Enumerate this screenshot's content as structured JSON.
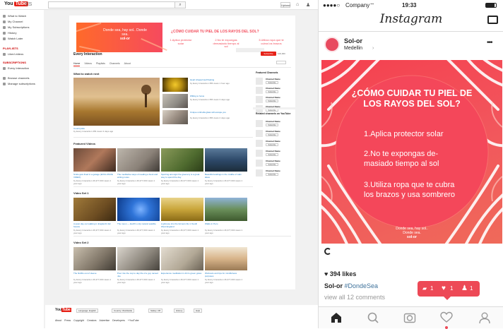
{
  "youtube": {
    "logo": "You",
    "logo_tube": "Tube",
    "logo_suffix": "ES",
    "upload_label": "Upload",
    "sidebar": {
      "items": [
        "What to Watch",
        "My Channel",
        "My Subscriptions",
        "History",
        "Watch Later"
      ],
      "playlists_heading": "PLAYLISTS",
      "playlists": [
        "Liked videos"
      ],
      "subscriptions_heading": "SUBSCRIPTIONS",
      "subscriptions": [
        "Every Interaction"
      ],
      "bottom": [
        "Browse channels",
        "Manage subscriptions"
      ]
    },
    "banner": {
      "brand_text": "Donde sea, hay sol.. Donde sea.",
      "brand_logo": "sol-or",
      "question": "¿CÓMO CUIDAR TU PIEL DE LOS RAYOS DEL SOL?",
      "tips": [
        "1.Aplica protector solar",
        "2.No te expongas demasiado tiempo al sol",
        "3.Utiliza ropa que te cubra los brazos"
      ]
    },
    "channel": {
      "name": "Every Interaction",
      "subscribe_label": "Subscribe",
      "subscriber_count": "100,000"
    },
    "tabs": [
      "Home",
      "Videos",
      "Playlists",
      "Channels",
      "About"
    ],
    "what_to_watch": {
      "title": "What to watch next",
      "main_caption": "Countryside",
      "main_meta": "by Every Interaction  456 views  3 days ago",
      "side": [
        {
          "title": "Heart shaped leaf floating",
          "meta": "by Every Interaction  356 views  1 hour ago"
        },
        {
          "title": "Willing to focus",
          "meta": "by Every Interaction  356 views  3 days ago"
        },
        {
          "title": "Unique umbrella glass will escape you",
          "meta": "by Every Interaction  356 views  2 days ago"
        }
      ]
    },
    "featured": {
      "title": "Featured Videos",
      "videos": [
        {
          "title": "Smile gets fixed in a garage (EXCLUSIVE VIDEO)",
          "meta": "by Every Interaction  46,377,000 views  1 year ago"
        },
        {
          "title": "The meditative ways of reading a book and writing notes",
          "meta": "by Every Interaction  46,377,000 views  1 year ago"
        },
        {
          "title": "Sporting amongst the greenery is a great way to spend the day",
          "meta": "by Every Interaction  46,377,000 views  1 year ago"
        },
        {
          "title": "Beautiful landings in the middle of calm lakes",
          "meta": "by Every Interaction  46,377,000 views  1 year ago"
        }
      ]
    },
    "set1": {
      "title": "Video Set 1",
      "videos": [
        {
          "title": "A quiet day out walking in England's fair forests",
          "meta": "by Every Interaction  46,377,000 views  1 year ago"
        },
        {
          "title": "The moon — Earth's only natural satellite",
          "meta": "by Every Interaction  46,377,000 views  1 year ago"
        },
        {
          "title": "A glimpse into the farmers life in South West England",
          "meta": "by Every Interaction  46,377,000 views  1 year ago"
        },
        {
          "title": "Walks in Peru",
          "meta": "by Every Interaction  46,377,000 views  1 year ago"
        }
      ]
    },
    "set2": {
      "title": "Video Set 2",
      "videos": [
        {
          "title": "The fireflits out of sleeve",
          "meta": "by Every Interaction  46,377,000 views  1 year ago"
        },
        {
          "title": "Pour into the cup to day life of a guy named Joe",
          "meta": "by Every Interaction  46,377,000 views  1 year ago"
        },
        {
          "title": "Experience meditation in dim's green grass",
          "meta": "by Every Interaction  46,377,000 views  1 year ago"
        },
        {
          "title": "Workouts and tips for mindfulness purposes",
          "meta": "by Every Interaction  46,377,000 views  1 year ago"
        }
      ]
    },
    "featured_channels": {
      "title": "Featured Channels",
      "items": [
        "Channel Name",
        "Channel Name",
        "Channel Name",
        "Channel Name"
      ],
      "subscribe": "Subscribe"
    },
    "related_channels": {
      "title": "Related channels on YouTube",
      "items": [
        "Channel Name",
        "Channel Name",
        "Channel Name",
        "Channel Name",
        "Channel Name",
        "Channel Name"
      ]
    },
    "footer": {
      "logo": "You",
      "logo_tube": "Tube",
      "buttons": [
        "Language: English",
        "Country: Worldwide",
        "Safety: Off",
        "History",
        "Help"
      ],
      "links": [
        "About",
        "Press",
        "Copyright",
        "Creators",
        "Advertise",
        "Developers",
        "+YouTube"
      ]
    },
    "colors": {
      "brand_red": "#e62117",
      "link_blue": "#167ac6"
    }
  },
  "instagram": {
    "status": {
      "carrier": "Company",
      "time": "19:33"
    },
    "logo": "Instagram",
    "post": {
      "username": "Sol-or",
      "location": "Medellin",
      "question": "¿CÓMO CUIDAR TU PIEL DE LOS RAYOS DEL SOL?",
      "tips": [
        "1.Aplica protector solar",
        "2.No te expongas de-masiado tiempo al sol",
        "3.Utiliza ropa que te cubra los brazos y usa sombrero"
      ],
      "brand_text": "Donde sea, hay sol.. Donde sea.",
      "brand_logo": "sol-or",
      "likes": "394 likes",
      "caption_user": "Sol-or",
      "caption_tag": "#DondeSea",
      "comments": "view all 12 comments"
    },
    "notifications": {
      "comments": "1",
      "likes": "1",
      "follows": "1"
    },
    "colors": {
      "accent": "#ed4956",
      "post_red": "#f5404f"
    }
  }
}
